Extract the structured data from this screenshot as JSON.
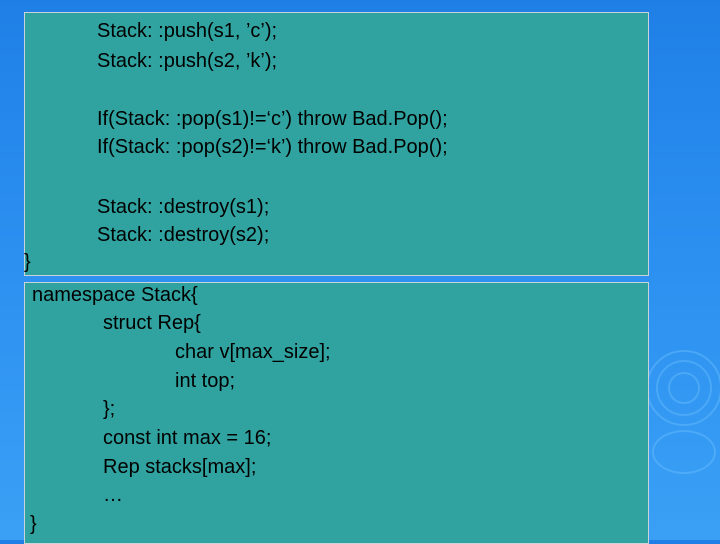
{
  "slide": {
    "block1": {
      "lines": [
        "Stack: :push(s1, ’c’);",
        "Stack: :push(s2, ’k’);",
        "If(Stack: :pop(s1)!=‘c’) throw Bad.Pop();",
        "If(Stack: :pop(s2)!=‘k’) throw Bad.Pop();",
        "Stack: :destroy(s1);",
        "Stack: :destroy(s2);",
        "}"
      ]
    },
    "block2": {
      "lines": [
        "namespace Stack{",
        "struct Rep{",
        "char v[max_size];",
        "int top;",
        "};",
        "const int max = 16;",
        "Rep stacks[max];",
        "…",
        "}"
      ]
    }
  }
}
